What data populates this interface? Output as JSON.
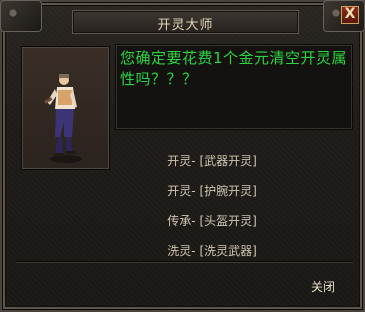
{
  "window": {
    "title": "开灵大师",
    "close_label": "X"
  },
  "message": "您确定要花费1个金元清空开灵属性吗？？？",
  "options": [
    {
      "category": "开灵",
      "sep": "- ",
      "action": "[武器开灵]"
    },
    {
      "category": "开灵",
      "sep": "- ",
      "action": "[护腕开灵]"
    },
    {
      "category": "传承",
      "sep": "- ",
      "action": "[头盔开灵]"
    },
    {
      "category": "洗灵",
      "sep": "- ",
      "action": "[洗灵武器]"
    }
  ],
  "footer": {
    "close_text": "关闭"
  },
  "colors": {
    "message": "#2bd63f",
    "text": "#cfc6b0",
    "close_button": "#8b2b1a"
  }
}
